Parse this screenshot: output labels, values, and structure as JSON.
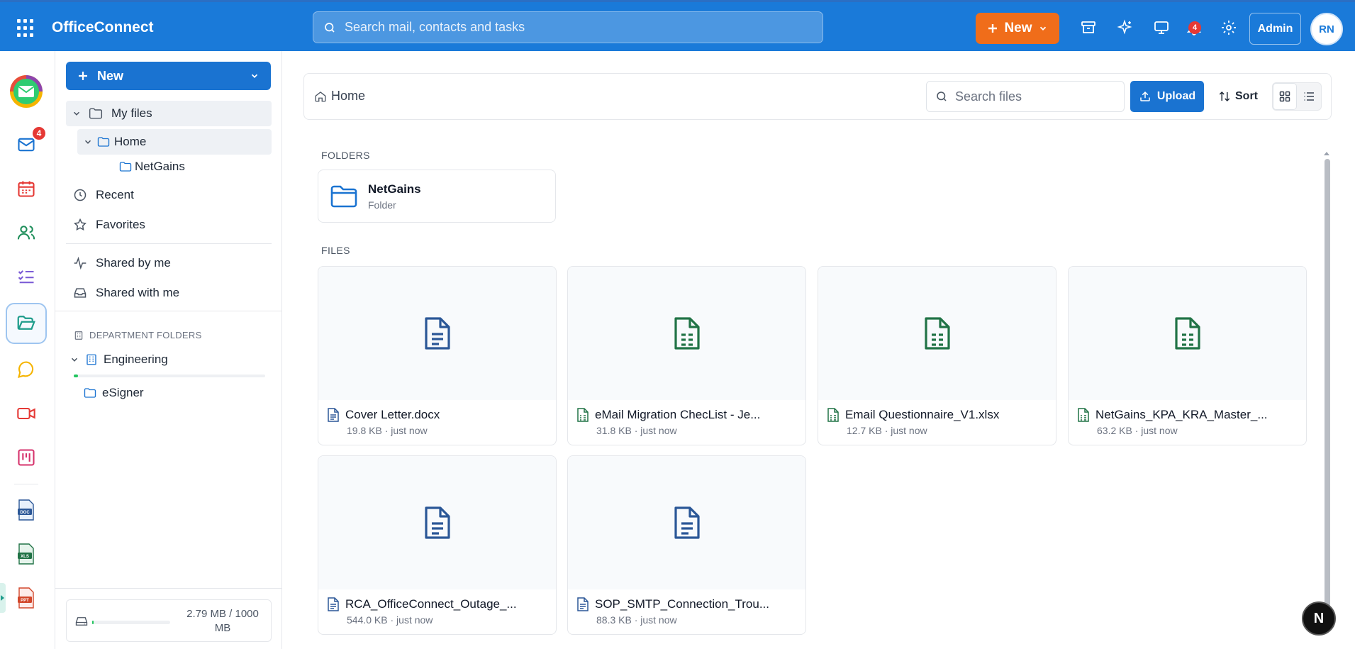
{
  "app": {
    "title": "OfficeConnect",
    "search_placeholder": "Search mail, contacts and tasks"
  },
  "topbar": {
    "new_label": "New",
    "notifications_count": "4",
    "admin_label": "Admin",
    "avatar_initials": "RN"
  },
  "rail": {
    "mail_badge": "4"
  },
  "nav": {
    "new_label": "New",
    "my_files": "My files",
    "home": "Home",
    "netgains": "NetGains",
    "recent": "Recent",
    "favorites": "Favorites",
    "shared_by_me": "Shared by me",
    "shared_with_me": "Shared with me",
    "department_heading": "DEPARTMENT FOLDERS",
    "engineering": "Engineering",
    "esigner": "eSigner",
    "storage_text": "2.79 MB / 1000 MB",
    "storage_used_fraction": 0.00279
  },
  "main": {
    "breadcrumb": "Home",
    "search_placeholder": "Search files",
    "upload_label": "Upload",
    "sort_label": "Sort",
    "folders_label": "FOLDERS",
    "files_label": "FILES",
    "folders": [
      {
        "name": "NetGains",
        "type": "Folder"
      }
    ],
    "files": [
      {
        "name": "Cover Letter.docx",
        "info": "19.8 KB · just now",
        "kind": "doc"
      },
      {
        "name": "eMail Migration ChecList - Je...",
        "info": "31.8 KB · just now",
        "kind": "sheet"
      },
      {
        "name": "Email Questionnaire_V1.xlsx",
        "info": "12.7 KB · just now",
        "kind": "sheet"
      },
      {
        "name": "NetGains_KPA_KRA_Master_...",
        "info": "63.2 KB · just now",
        "kind": "sheet"
      },
      {
        "name": "RCA_OfficeConnect_Outage_...",
        "info": "544.0 KB · just now",
        "kind": "doc"
      },
      {
        "name": "SOP_SMTP_Connection_Trou...",
        "info": "88.3 KB · just now",
        "kind": "doc"
      }
    ]
  },
  "floating": {
    "label": "N"
  },
  "colors": {
    "brand_blue": "#1a7ad9",
    "new_orange": "#f06d1a",
    "doc_blue": "#2b5797",
    "sheet_green": "#217346"
  }
}
